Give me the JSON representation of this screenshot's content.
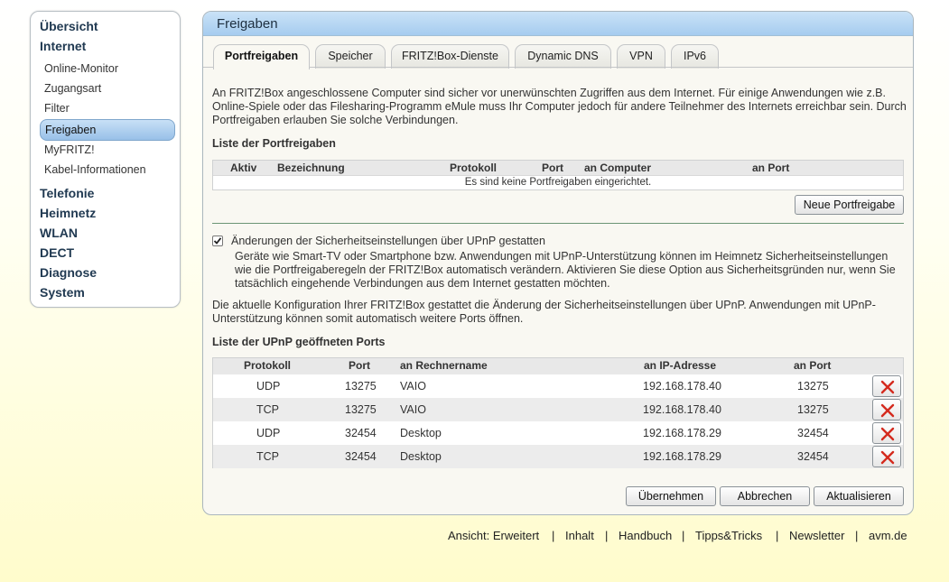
{
  "sidebar": {
    "top1": "Übersicht",
    "top2": "Internet",
    "sub": [
      "Online-Monitor",
      "Zugangsart",
      "Filter",
      "Freigaben",
      "MyFRITZ!",
      "Kabel-Informationen"
    ],
    "more": [
      "Telefonie",
      "Heimnetz",
      "WLAN",
      "DECT",
      "Diagnose",
      "System"
    ]
  },
  "main": {
    "title": "Freigaben",
    "tabs": [
      "Portfreigaben",
      "Speicher",
      "FRITZ!Box-Dienste",
      "Dynamic DNS",
      "VPN",
      "IPv6"
    ],
    "intro": "An FRITZ!Box angeschlossene Computer sind sicher vor unerwünschten Zugriffen aus dem Internet. Für einige Anwendungen wie z.B. Online-Spiele oder das Filesharing-Programm eMule muss Ihr Computer jedoch für andere Teilnehmer des Internets erreichbar sein. Durch Portfreigaben erlauben Sie solche Verbindungen.",
    "list_title": "Liste der Portfreigaben",
    "port_cols": [
      "Aktiv",
      "Bezeichnung",
      "Protokoll",
      "Port",
      "an Computer",
      "an Port"
    ],
    "empty_msg": "Es sind keine Portfreigaben eingerichtet.",
    "new_button": "Neue Portfreigabe",
    "upnp_checkbox_label": "Änderungen der Sicherheitseinstellungen über UPnP gestatten",
    "upnp_checked": true,
    "upnp_desc": "Geräte wie Smart-TV oder Smartphone bzw. Anwendungen mit UPnP-Unterstützung können im Heimnetz Sicherheitseinstellungen wie die Portfreigaberegeln der FRITZ!Box automatisch verändern. Aktivieren Sie diese Option aus Sicherheitsgründen nur, wenn Sie tatsächlich eingehende Verbindungen aus dem Internet gestatten möchten.",
    "config_note": "Die aktuelle Konfiguration Ihrer FRITZ!Box gestattet die Änderung der Sicherheitseinstellungen über UPnP. Anwendungen mit UPnP-Unterstützung können somit automatisch weitere Ports öffnen.",
    "upnp_title": "Liste der UPnP geöffneten Ports",
    "upnp_cols": [
      "Protokoll",
      "Port",
      "an Rechnername",
      "an IP-Adresse",
      "an Port"
    ],
    "upnp_rows": [
      {
        "proto": "UDP",
        "port": "13275",
        "host": "VAIO",
        "ip": "192.168.178.40",
        "to_port": "13275"
      },
      {
        "proto": "TCP",
        "port": "13275",
        "host": "VAIO",
        "ip": "192.168.178.40",
        "to_port": "13275"
      },
      {
        "proto": "UDP",
        "port": "32454",
        "host": "Desktop",
        "ip": "192.168.178.29",
        "to_port": "32454"
      },
      {
        "proto": "TCP",
        "port": "32454",
        "host": "Desktop",
        "ip": "192.168.178.29",
        "to_port": "32454"
      }
    ],
    "buttons": {
      "apply": "Übernehmen",
      "cancel": "Abbrechen",
      "refresh": "Aktualisieren"
    }
  },
  "footer": {
    "view": "Ansicht: Erweitert",
    "links": [
      "Inhalt",
      "Handbuch",
      "Tipps&Tricks",
      "Newsletter",
      "avm.de"
    ],
    "sep": "|"
  },
  "colors": {
    "delete_icon": "#d42a1e",
    "header_blue": "#a6ccef",
    "nav_active": "#98c0e8"
  },
  "icons": {
    "delete": "close-icon",
    "checkbox": "checkbox-checked-icon"
  }
}
